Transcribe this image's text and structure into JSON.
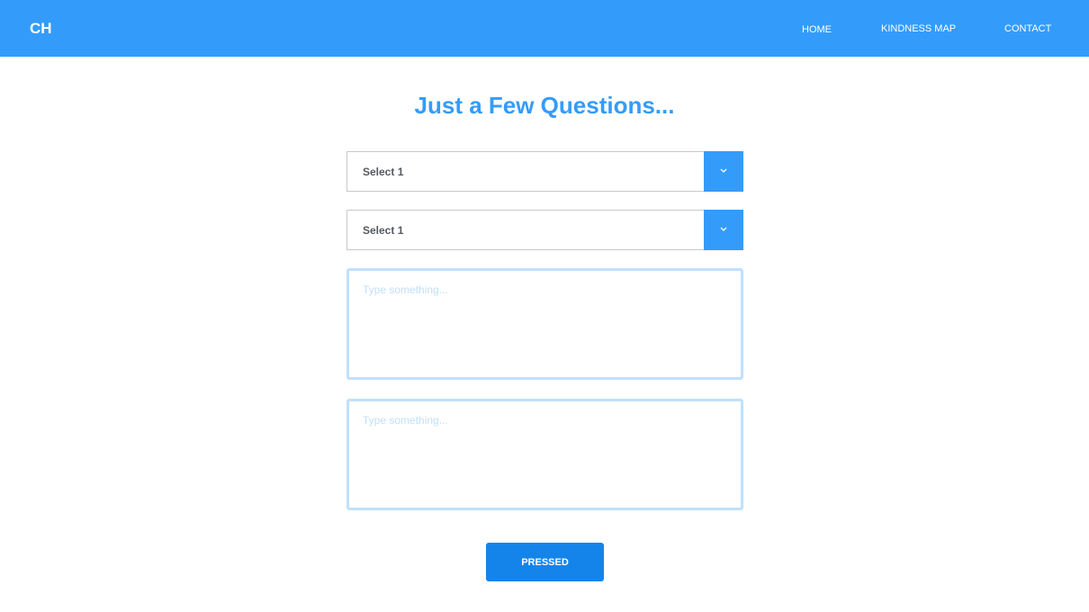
{
  "navbar": {
    "brand": "CH",
    "links": [
      {
        "label": "HOME"
      },
      {
        "label": "KINDNESS MAP"
      },
      {
        "label": "CONTACT"
      }
    ],
    "background_color": "#339cfb"
  },
  "main": {
    "title": "Just a Few Questions...",
    "selects": [
      {
        "value": "Select 1",
        "arrow_icon": "chevron-down-icon"
      },
      {
        "value": "Select 1",
        "arrow_icon": "chevron-down-icon"
      }
    ],
    "textareas": [
      {
        "placeholder": "Type something...",
        "value": ""
      },
      {
        "placeholder": "Type something...",
        "value": ""
      }
    ],
    "submit_label": "PRESSED"
  },
  "colors": {
    "accent": "#339cfb",
    "button": "#1584ea",
    "textarea_border": "#bfe0fb"
  }
}
